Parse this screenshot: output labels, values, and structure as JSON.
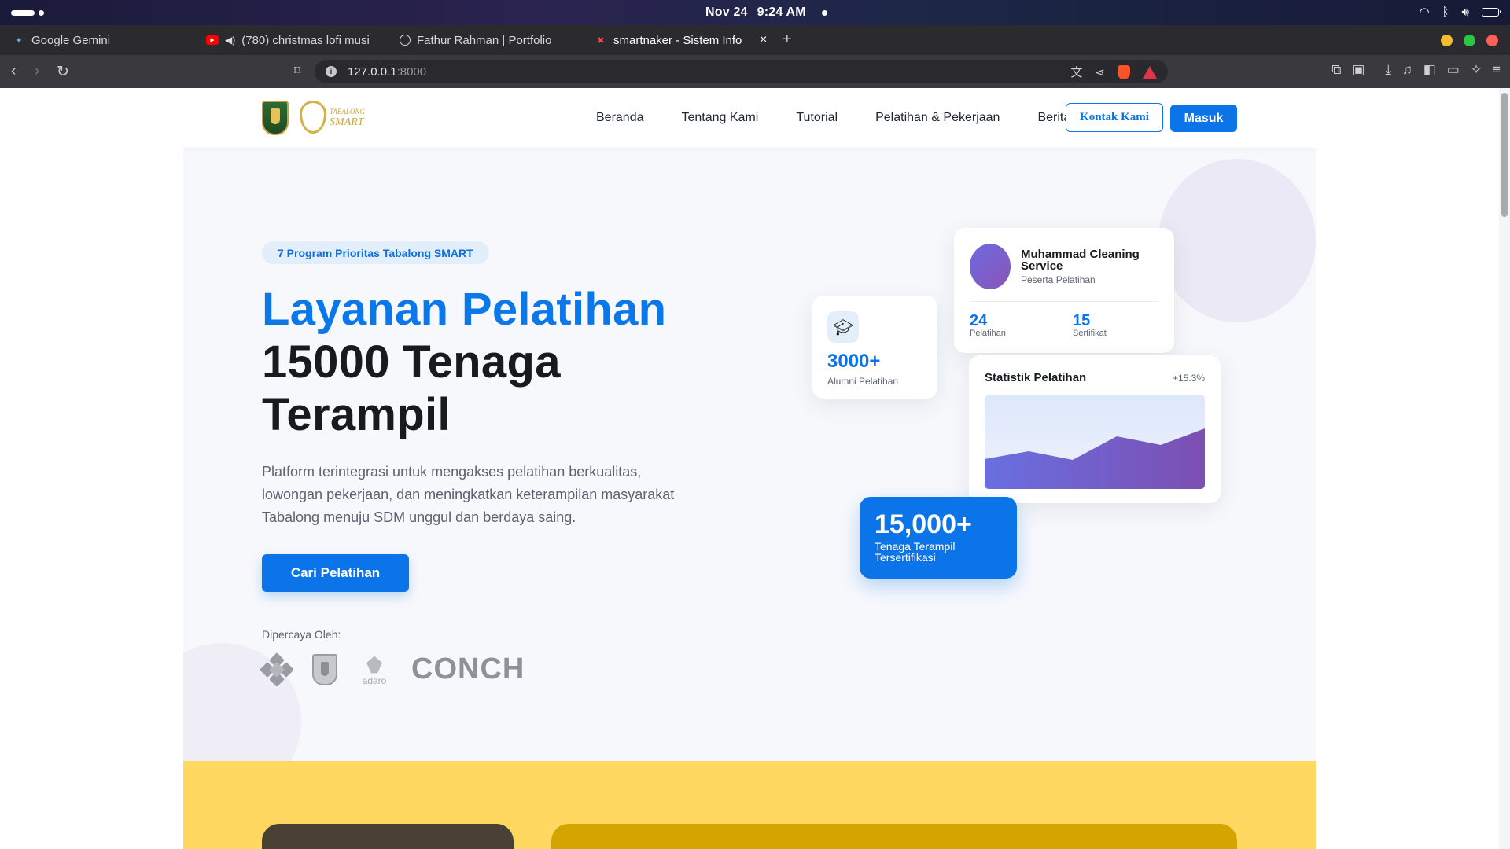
{
  "menubar": {
    "date": "Nov 24",
    "time": "9:24 AM"
  },
  "browser": {
    "tabs": [
      {
        "label": "Google Gemini",
        "icon": "gemini-icon"
      },
      {
        "label": "(780) christmas lofi musi",
        "icon": "youtube-icon"
      },
      {
        "label": "Fathur Rahman | Portfolio",
        "icon": "globe-icon"
      },
      {
        "label": "smartnaker - Sistem Info",
        "icon": "smartnaker-icon",
        "active": true
      }
    ],
    "url_host": "127.0.0.1",
    "url_port": ":8000"
  },
  "site": {
    "logo_text_1": "TABALONG",
    "logo_text_2": "SMART",
    "nav": [
      "Beranda",
      "Tentang Kami",
      "Tutorial",
      "Pelatihan & Pekerjaan",
      "Berita"
    ],
    "contact_label": "Kontak Kami",
    "login_label": "Masuk"
  },
  "hero": {
    "badge": "7 Program Prioritas Tabalong SMART",
    "title_accent": "Layanan Pelatihan",
    "title_rest": "15000 Tenaga Terampil",
    "description": "Platform terintegrasi untuk mengakses pelatihan berkualitas, lowongan pekerjaan, dan meningkatkan keterampilan masyarakat Tabalong menuju SDM unggul dan berdaya saing.",
    "cta": "Cari Pelatihan",
    "trusted_label": "Dipercaya Oleh:",
    "trusted_logos": {
      "adaro": "adaro",
      "conch": "CONCH"
    }
  },
  "cards": {
    "alumni": {
      "value": "3000+",
      "label": "Alumni Pelatihan"
    },
    "profile": {
      "name": "Muhammad Cleaning Service",
      "role": "Peserta Pelatihan",
      "stats": [
        {
          "value": "24",
          "label": "Pelatihan"
        },
        {
          "value": "15",
          "label": "Sertifikat"
        }
      ]
    },
    "chart": {
      "title": "Statistik Pelatihan",
      "growth": "+15.3%"
    },
    "total": {
      "value": "15,000+",
      "label": "Tenaga Terampil Tersertifikasi"
    }
  },
  "colors": {
    "primary": "#0b74e8",
    "yellow_section": "#fed860"
  }
}
